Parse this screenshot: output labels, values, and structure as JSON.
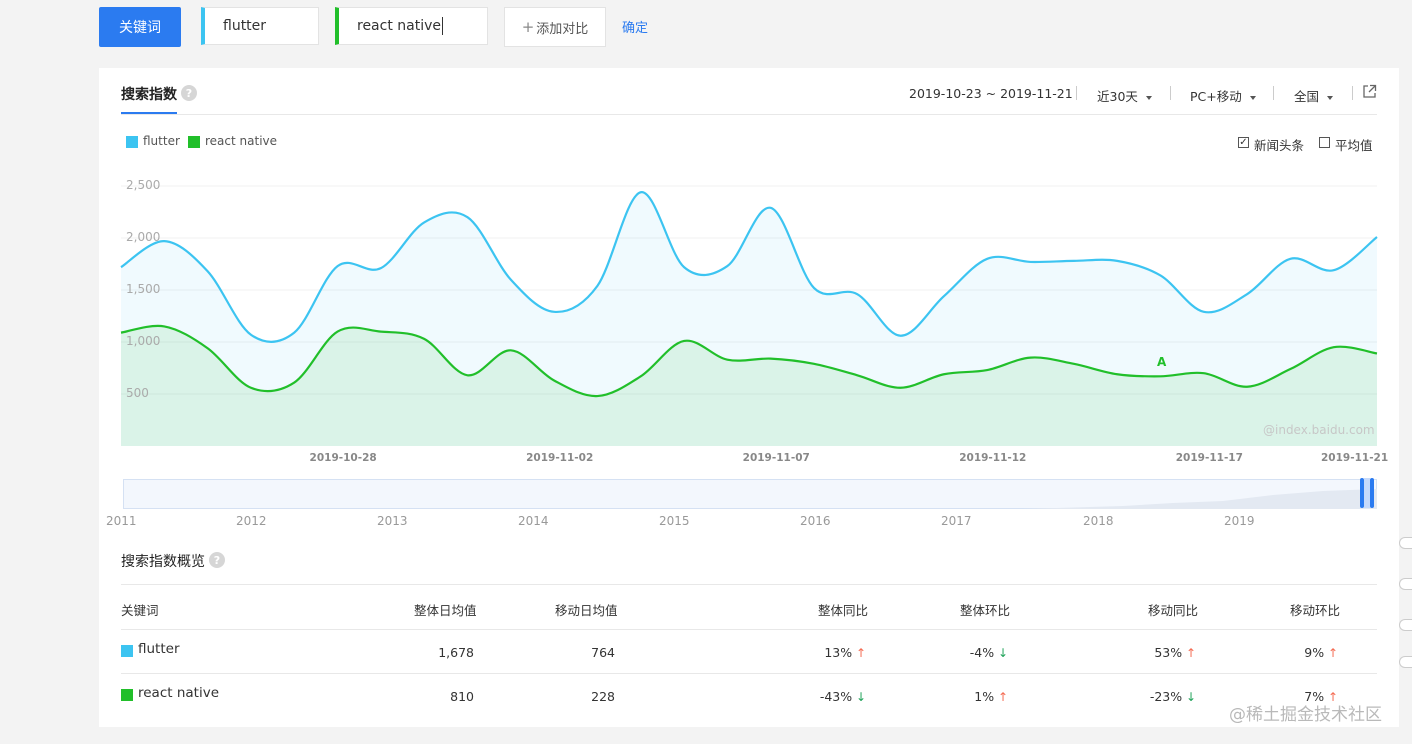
{
  "topbar": {
    "keyword_btn": "关键词",
    "inputs": [
      {
        "value": "flutter",
        "color": "#3cc4f1"
      },
      {
        "value": "react native",
        "color": "#21bf2a"
      }
    ],
    "add_compare": "添加对比",
    "confirm": "确定"
  },
  "panel": {
    "tab_title": "搜索指数",
    "help": "?",
    "date_range": "2019-10-23 ~ 2019-11-21",
    "period": "近30天",
    "device": "PC+移动",
    "region": "全国",
    "legend": [
      {
        "name": "flutter",
        "color": "#3cc4f1"
      },
      {
        "name": "react native",
        "color": "#21bf2a"
      }
    ],
    "check_news": "新闻头条",
    "check_avg": "平均值",
    "watermark": "@index.baidu.com",
    "annotation": "A"
  },
  "chart_data": {
    "type": "area",
    "x": [
      "2019-10-23",
      "2019-10-24",
      "2019-10-25",
      "2019-10-26",
      "2019-10-27",
      "2019-10-28",
      "2019-10-29",
      "2019-10-30",
      "2019-10-31",
      "2019-11-01",
      "2019-11-02",
      "2019-11-03",
      "2019-11-04",
      "2019-11-05",
      "2019-11-06",
      "2019-11-07",
      "2019-11-08",
      "2019-11-09",
      "2019-11-10",
      "2019-11-11",
      "2019-11-12",
      "2019-11-13",
      "2019-11-14",
      "2019-11-15",
      "2019-11-16",
      "2019-11-17",
      "2019-11-18",
      "2019-11-19",
      "2019-11-20",
      "2019-11-21"
    ],
    "x_ticks": [
      "2019-10-28",
      "2019-11-02",
      "2019-11-07",
      "2019-11-12",
      "2019-11-17",
      "2019-11-21"
    ],
    "y_ticks": [
      "2,500",
      "2,000",
      "1,500",
      "1,000",
      "500"
    ],
    "ylim": [
      0,
      2600
    ],
    "series": [
      {
        "name": "flutter",
        "color": "#3cc4f1",
        "values": [
          1720,
          1970,
          1680,
          1070,
          1090,
          1730,
          1710,
          2150,
          2200,
          1600,
          1290,
          1540,
          2440,
          1720,
          1730,
          2290,
          1520,
          1460,
          1060,
          1440,
          1800,
          1770,
          1780,
          1780,
          1640,
          1290,
          1460,
          1800,
          1690,
          2010
        ]
      },
      {
        "name": "react native",
        "color": "#21bf2a",
        "values": [
          1090,
          1150,
          940,
          560,
          610,
          1100,
          1100,
          1030,
          680,
          920,
          630,
          480,
          670,
          1010,
          830,
          840,
          790,
          680,
          560,
          690,
          730,
          850,
          790,
          690,
          670,
          700,
          570,
          740,
          950,
          890
        ]
      }
    ],
    "range_years": [
      "2011",
      "2012",
      "2013",
      "2014",
      "2015",
      "2016",
      "2017",
      "2018",
      "2019"
    ]
  },
  "overview": {
    "title": "搜索指数概览",
    "headers": [
      "关键词",
      "整体日均值",
      "移动日均值",
      "整体同比",
      "整体环比",
      "移动同比",
      "移动环比"
    ],
    "rows": [
      {
        "name": "flutter",
        "color": "#3cc4f1",
        "overall_avg": "1,678",
        "mobile_avg": "764",
        "yoy": "13%",
        "yoy_dir": "up",
        "mom": "-4%",
        "mom_dir": "down",
        "m_yoy": "53%",
        "m_yoy_dir": "up",
        "m_mom": "9%",
        "m_mom_dir": "up"
      },
      {
        "name": "react native",
        "color": "#21bf2a",
        "overall_avg": "810",
        "mobile_avg": "228",
        "yoy": "-43%",
        "yoy_dir": "down",
        "mom": "1%",
        "mom_dir": "up",
        "m_yoy": "-23%",
        "m_yoy_dir": "down",
        "m_mom": "7%",
        "m_mom_dir": "up"
      }
    ]
  },
  "footer_watermark": "@稀土掘金技术社区"
}
